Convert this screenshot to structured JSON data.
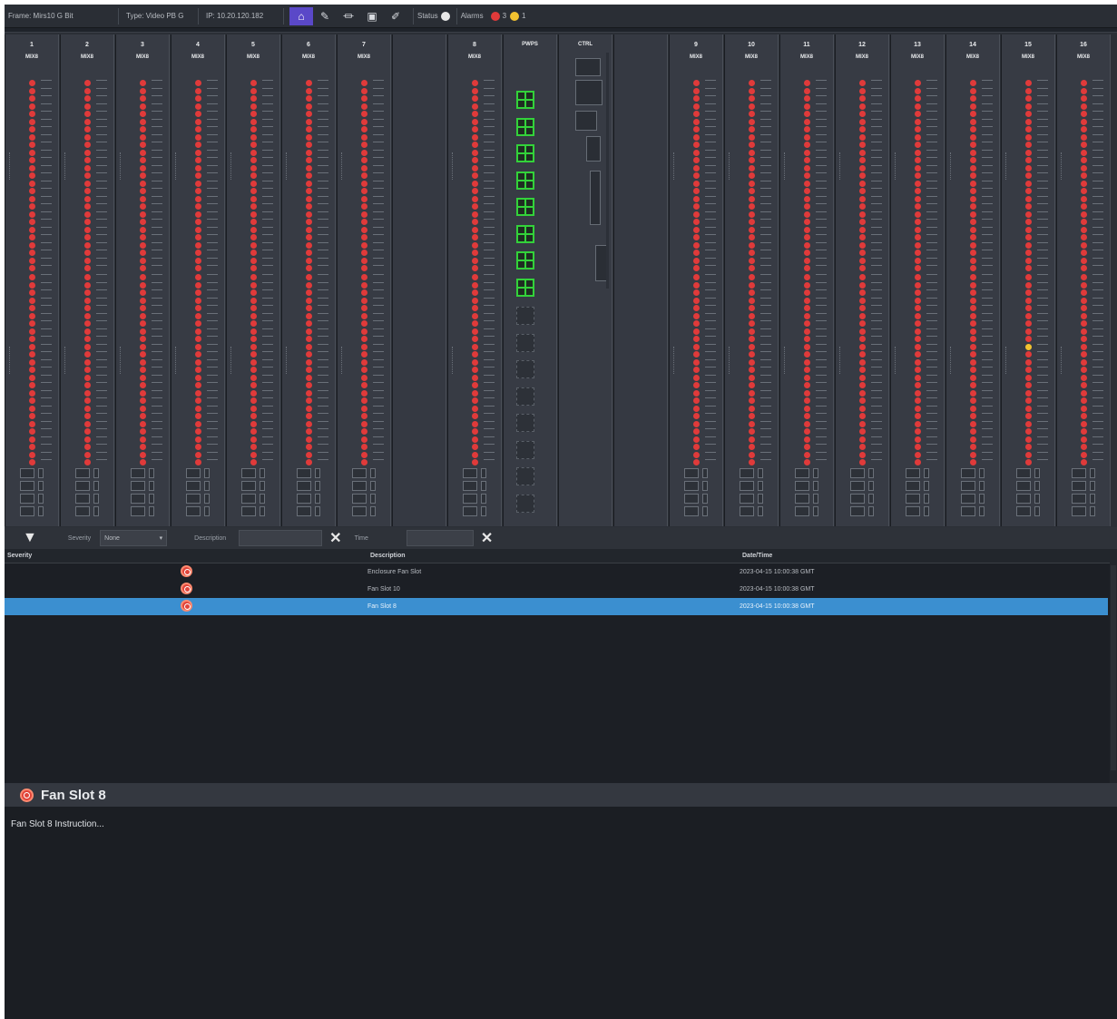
{
  "toolbar": {
    "frame": "Frame: Mirs10 G Bit",
    "type": "Type: Video PB G",
    "ip": "IP: 10.20.120.182",
    "home_icon": "home-icon",
    "status_label": "Status",
    "alarms_label": "Alarms",
    "alarms_red_count": "3",
    "alarms_yellow_count": "1",
    "colors": {
      "accent": "#5a48c8",
      "critical": "#e03a3a",
      "warning": "#f2c230"
    }
  },
  "chassis": {
    "slots": [
      {
        "number": "1",
        "type": "MIX8"
      },
      {
        "number": "2",
        "type": "MIX8"
      },
      {
        "number": "3",
        "type": "MIX8"
      },
      {
        "number": "4",
        "type": "MIX8"
      },
      {
        "number": "5",
        "type": "MIX8"
      },
      {
        "number": "6",
        "type": "MIX8"
      },
      {
        "number": "7",
        "type": "MIX8"
      },
      {
        "number": "",
        "type": ""
      },
      {
        "number": "8",
        "type": "MIX8"
      },
      {
        "number": "",
        "type": "PWPS"
      },
      {
        "number": "",
        "type": "CTRL"
      },
      {
        "number": "",
        "type": ""
      },
      {
        "number": "9",
        "type": "MIX8"
      },
      {
        "number": "10",
        "type": "MIX8"
      },
      {
        "number": "11",
        "type": "MIX8"
      },
      {
        "number": "12",
        "type": "MIX8"
      },
      {
        "number": "13",
        "type": "MIX8"
      },
      {
        "number": "14",
        "type": "MIX8"
      },
      {
        "number": "15",
        "type": "MIX8"
      },
      {
        "number": "16",
        "type": "MIX8"
      }
    ]
  },
  "filter": {
    "severity_label": "Severity",
    "severity_value": "None",
    "description_label": "Description",
    "description_value": "",
    "time_label": "Time",
    "time_value": ""
  },
  "table": {
    "columns": [
      "Severity",
      "Description",
      "Date/Time"
    ],
    "rows": [
      {
        "description": "Enclosure Fan Slot",
        "datetime": "2023-04-15 10:00:38 GMT"
      },
      {
        "description": "Fan Slot 10",
        "datetime": "2023-04-15 10:00:38 GMT"
      },
      {
        "description": "Fan Slot 8",
        "datetime": "2023-04-15 10:00:38 GMT"
      }
    ],
    "selected_index": 2
  },
  "details": {
    "title": "Fan Slot 8",
    "text": "Fan Slot 8 Instruction..."
  }
}
